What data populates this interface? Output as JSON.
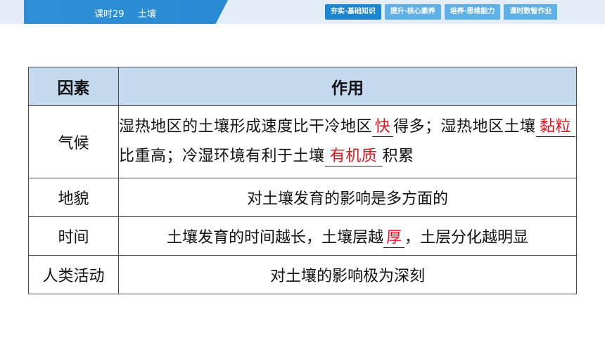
{
  "header": {
    "lesson_code": "课时29",
    "lesson_name": "土壤",
    "tabs": [
      {
        "label": "夯实·基础知识",
        "active": true
      },
      {
        "label": "提升·核心素养",
        "active": false
      },
      {
        "label": "培养·思维能力",
        "active": false
      },
      {
        "label": "课时数智作业",
        "active": false
      }
    ]
  },
  "table": {
    "headers": [
      "因素",
      "作用"
    ],
    "rows": [
      {
        "factor": "气候",
        "parts": [
          "湿热地区的土壤形成速度比干冷地区",
          "得多；湿热地区土壤",
          "比重高；冷湿环境有利于土壤",
          "积累"
        ],
        "answers": [
          "快",
          "黏粒",
          "有机质"
        ]
      },
      {
        "factor": "地貌",
        "text": "对土壤发育的影响是多方面的"
      },
      {
        "factor": "时间",
        "parts": [
          "土壤发育的时间越长，土壤层越",
          "，土层分化越明显"
        ],
        "answers": [
          "厚"
        ]
      },
      {
        "factor": "人类活动",
        "text": "对土壤的影响极为深刻"
      }
    ]
  },
  "colors": {
    "header_blue": "#2f8fd6",
    "table_header_bg": "#c5d9ef",
    "answer_red": "#e0141c"
  }
}
